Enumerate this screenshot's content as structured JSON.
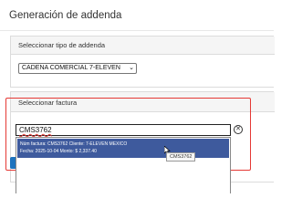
{
  "page": {
    "title": "Generación de addenda"
  },
  "addenda_type": {
    "label": "Seleccionar tipo de addenda",
    "selected": "CADENA COMERCIAL 7-ELEVEN"
  },
  "invoice": {
    "label": "Seleccionar factura",
    "input_value": "CMS3762",
    "clear_icon": "clear-circle-icon",
    "option": {
      "line1": "Núm factura: CMS3762 Cliente: 7-ELEVEN MEXICO",
      "line2": "Fecha: 2025-10-04 Monto: $ 2,337.40"
    },
    "tooltip": "CMS3762"
  },
  "colors": {
    "highlight_border": "#e53935",
    "option_selected_bg": "#3e5a9d",
    "button_blue": "#1e73be"
  }
}
